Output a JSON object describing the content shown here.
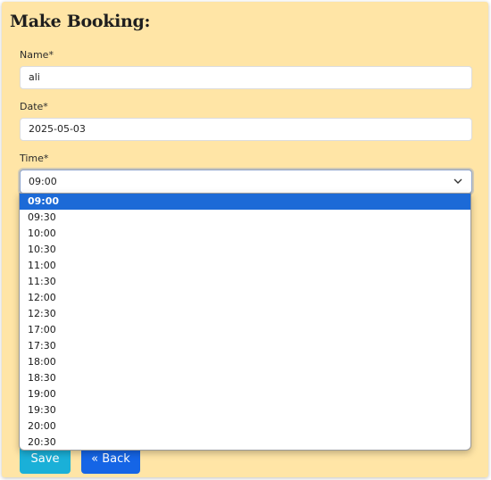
{
  "form": {
    "title": "Make Booking:",
    "name_label": "Name*",
    "name_value": "ali",
    "date_label": "Date*",
    "date_value": "2025-05-03",
    "time_label": "Time*",
    "time_value": "09:00"
  },
  "time_options": [
    "09:00",
    "09:30",
    "10:00",
    "10:30",
    "11:00",
    "11:30",
    "12:00",
    "12:30",
    "17:00",
    "17:30",
    "18:00",
    "18:30",
    "19:00",
    "19:30",
    "20:00",
    "20:30"
  ],
  "selected_index": 0,
  "buttons": {
    "save_label": "Save",
    "back_label": "« Back"
  },
  "colors": {
    "card_bg": "#ffe5a6",
    "save_bg": "#1ab0d8",
    "back_bg": "#1565e6",
    "option_highlight": "#1c6ad7"
  },
  "icons": {
    "select_arrow": "chevron-down-icon"
  }
}
